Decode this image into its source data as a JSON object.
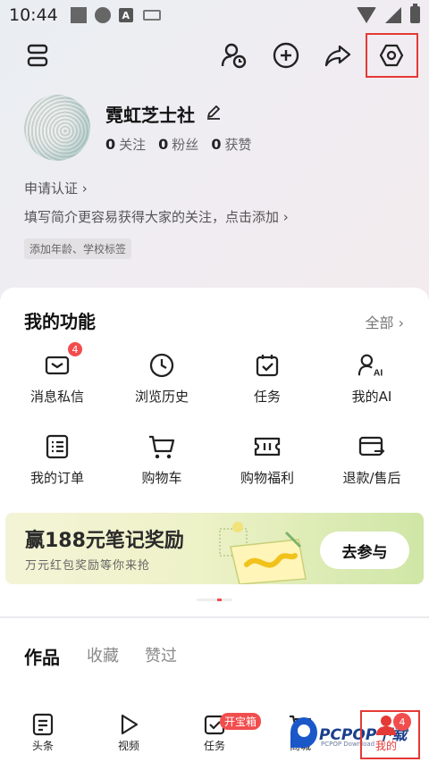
{
  "status_bar": {
    "time": "10:44",
    "icons": [
      "square-icon",
      "circle-icon",
      "a-icon",
      "keyboard-icon",
      "wifi-icon",
      "signal-icon",
      "battery-icon"
    ]
  },
  "header": {
    "icons": [
      "menu-icon",
      "friend-icon",
      "add-icon",
      "share-icon",
      "settings-icon"
    ],
    "highlight_color": "#e53935"
  },
  "profile": {
    "nickname": "霓虹芝士社",
    "following_count": "0",
    "following_label": "关注",
    "fans_count": "0",
    "fans_label": "粉丝",
    "likes_count": "0",
    "likes_label": "获赞",
    "verify_link": "申请认证 ›",
    "bio_prompt": "填写简介更容易获得大家的关注，点击添加 ›",
    "tag_chip": "添加年龄、学校标签"
  },
  "functions": {
    "title": "我的功能",
    "all_link": "全部 ›",
    "items": [
      {
        "label": "消息私信",
        "icon": "mail-icon",
        "badge": "4"
      },
      {
        "label": "浏览历史",
        "icon": "clock-icon"
      },
      {
        "label": "任务",
        "icon": "task-icon"
      },
      {
        "label": "我的AI",
        "icon": "ai-user-icon"
      },
      {
        "label": "我的订单",
        "icon": "order-icon"
      },
      {
        "label": "购物车",
        "icon": "cart-icon"
      },
      {
        "label": "购物福利",
        "icon": "ticket-icon"
      },
      {
        "label": "退款/售后",
        "icon": "refund-icon"
      }
    ]
  },
  "banner": {
    "title": "赢188元笔记奖励",
    "subtitle": "万元红包奖励等你来抢",
    "button": "去参与"
  },
  "works": {
    "tabs": [
      "作品",
      "收藏",
      "赞过"
    ],
    "active_tab": 0
  },
  "bottom_nav": {
    "items": [
      {
        "label": "头条",
        "icon": "article-icon"
      },
      {
        "label": "视频",
        "icon": "play-icon"
      },
      {
        "label": "任务",
        "icon": "task-icon",
        "badge": "开宝箱"
      },
      {
        "label": "商城",
        "icon": "cart-icon"
      },
      {
        "label": "我的",
        "icon": "me-icon",
        "badge": "4"
      }
    ],
    "active_index": 4
  },
  "watermark": {
    "text": "PCPOP下载",
    "sub": "PCPOP Download"
  },
  "colors": {
    "accent_red": "#e53935",
    "badge_red": "#f24d4d",
    "banner_green": "#cfe6a6"
  }
}
